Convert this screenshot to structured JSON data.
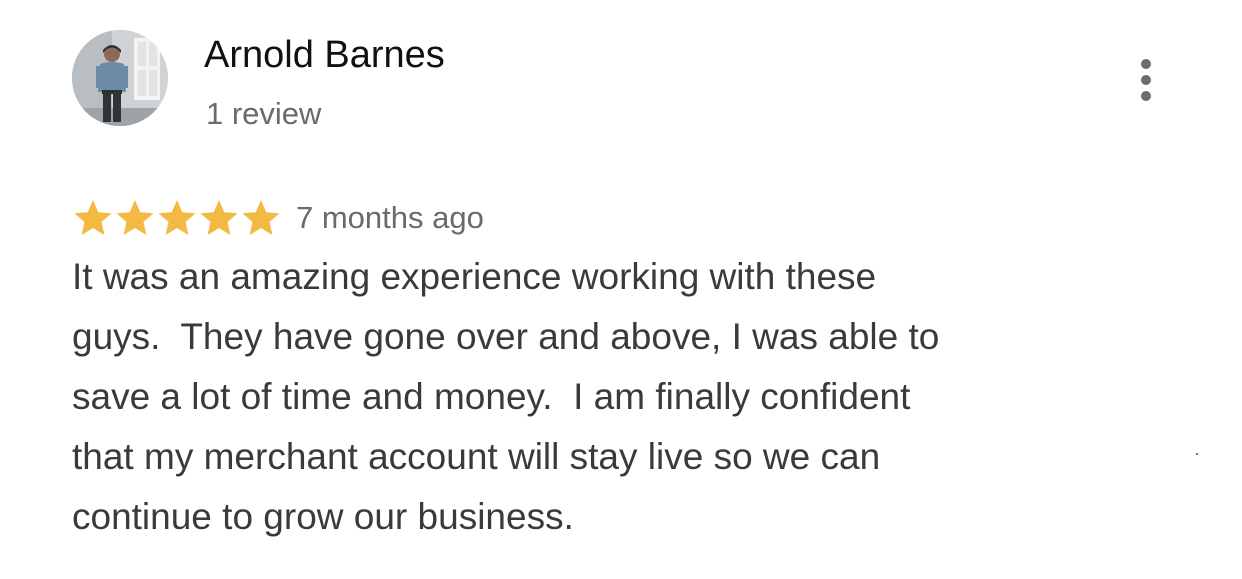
{
  "reviewer": {
    "name": "Arnold Barnes",
    "meta": "1 review",
    "avatar_icon": "user-photo-avatar"
  },
  "menu": {
    "icon": "more-vertical-icon"
  },
  "review": {
    "rating": 5,
    "rating_max": 5,
    "star_color": "#F4B942",
    "date": "7 months ago",
    "lines": [
      "It was an amazing experience working with these",
      "guys.  They have gone over and above, I was able to",
      "save a lot of time and money.  I am finally confident",
      "that my merchant account will stay live so we can",
      "continue to grow our business."
    ]
  }
}
